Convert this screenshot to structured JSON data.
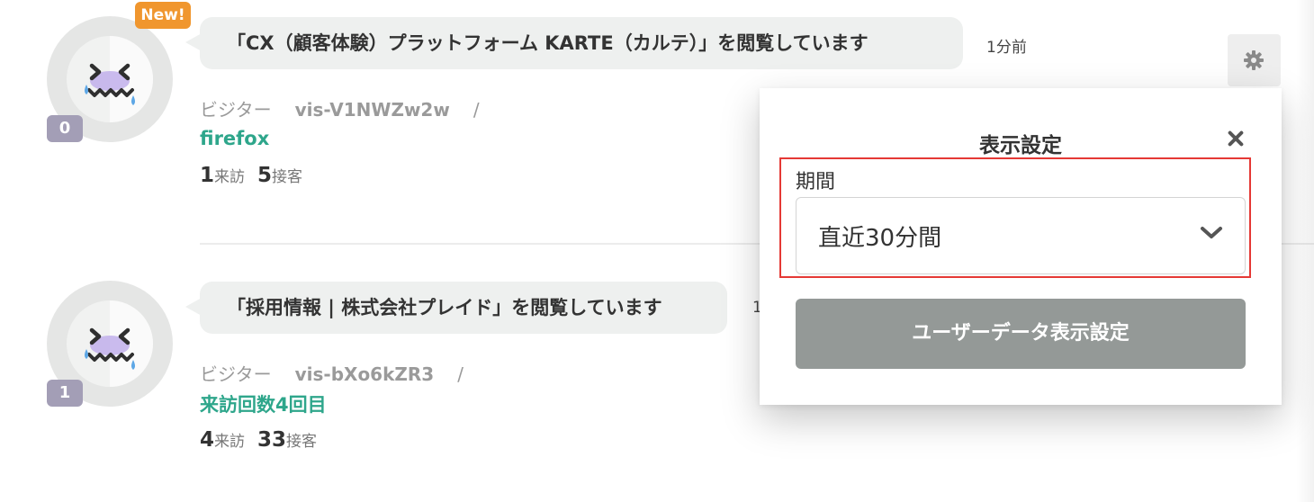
{
  "rows": [
    {
      "badge": "0",
      "new_label": "New!",
      "page_message": "「CX（顧客体験）プラットフォーム KARTE（カルテ）」を閲覧しています",
      "time": "1分前",
      "visitor_label": "ビジター",
      "visitor_id": "vis-V1NWZw2w",
      "slash": "/",
      "segment": "firefox",
      "visits": "1",
      "visits_label": "来訪",
      "contacts": "5",
      "contacts_label": "接客"
    },
    {
      "badge": "1",
      "page_message": "「採用情報 | 株式会社プレイド」を閲覧しています",
      "time": "1",
      "visitor_label": "ビジター",
      "visitor_id": "vis-bXo6kZR3",
      "slash": "/",
      "segment": "来訪回数4回目",
      "visits": "4",
      "visits_label": "来訪",
      "contacts": "33",
      "contacts_label": "接客"
    }
  ],
  "settings_panel": {
    "title": "表示設定",
    "period_label": "期間",
    "period_value": "直近30分間",
    "user_data_button": "ユーザーデータ表示設定"
  },
  "icons": {
    "gear": "gear-icon",
    "close": "close-icon",
    "chevron": "chevron-down-icon",
    "avatar_face": "sad-face-icon"
  },
  "colors": {
    "new_badge": "#f0962e",
    "count_badge": "#a39eb6",
    "segment_text": "#2ea68b",
    "highlight_border": "#e53935",
    "button_gray": "#949997"
  }
}
